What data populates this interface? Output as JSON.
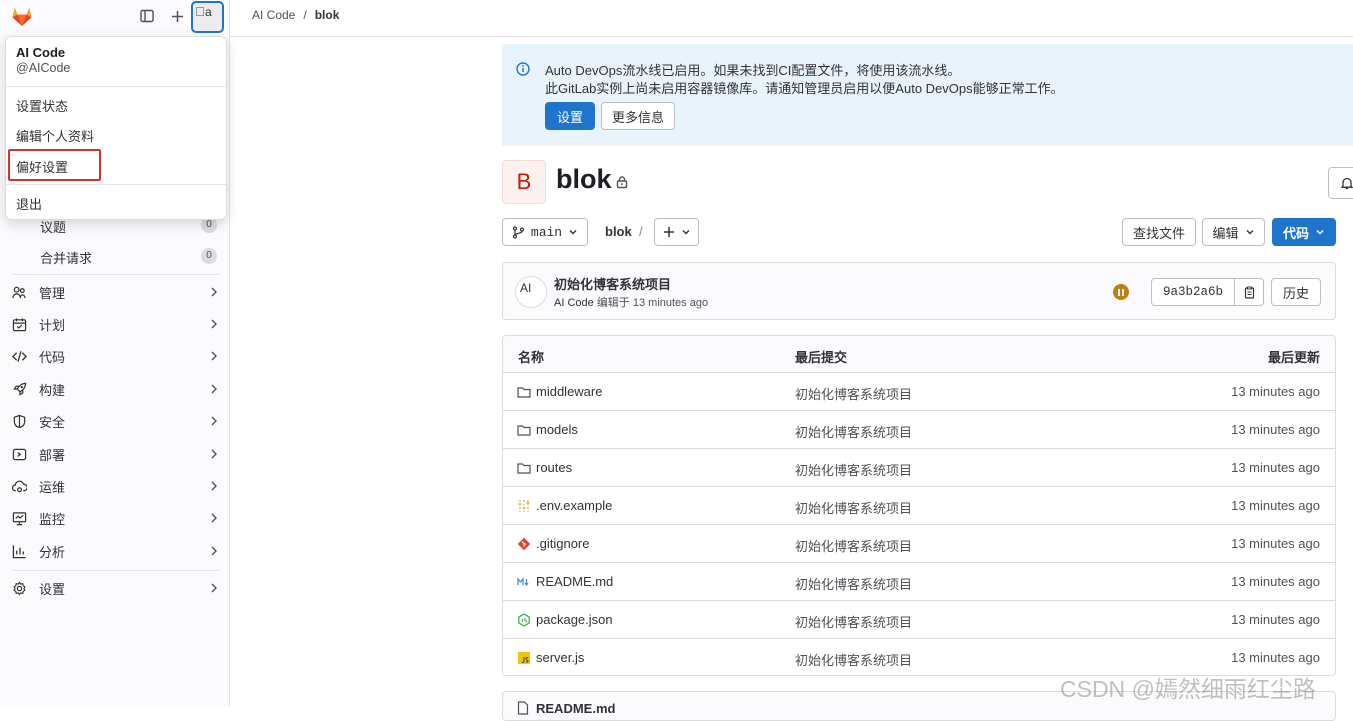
{
  "sidebar": {
    "avatar_alt": "a",
    "nav_sub": [
      {
        "label": "议题",
        "count": "0"
      },
      {
        "label": "合并请求",
        "count": "0"
      }
    ],
    "nav": [
      {
        "label": "管理",
        "icon": "users-icon"
      },
      {
        "label": "计划",
        "icon": "calendar-icon"
      },
      {
        "label": "代码",
        "icon": "code-icon"
      },
      {
        "label": "构建",
        "icon": "rocket-icon"
      },
      {
        "label": "安全",
        "icon": "shield-icon"
      },
      {
        "label": "部署",
        "icon": "deploy-icon"
      },
      {
        "label": "运维",
        "icon": "cloud-gear-icon"
      },
      {
        "label": "监控",
        "icon": "monitor-icon"
      },
      {
        "label": "分析",
        "icon": "chart-icon"
      }
    ],
    "settings_label": "设置"
  },
  "user_menu": {
    "name": "AI Code",
    "handle": "@AICode",
    "items": [
      "设置状态",
      "编辑个人资料",
      "偏好设置"
    ],
    "logout": "退出"
  },
  "breadcrumb": {
    "group": "AI Code",
    "sep": "/",
    "project": "blok"
  },
  "alert": {
    "line1": "Auto DevOps流水线已启用。如果未找到CI配置文件，将使用该流水线。",
    "line2": "此GitLab实例上尚未启用容器镜像库。请通知管理员启用以便Auto DevOps能够正常工作。",
    "settings_button": "设置",
    "more_info_button": "更多信息"
  },
  "project": {
    "avatar_letter": "B",
    "name": "blok"
  },
  "repo_bar": {
    "branch": "main",
    "path": "blok",
    "path_sep": "/",
    "find_file": "查找文件",
    "edit": "编辑",
    "code": "代码"
  },
  "commit": {
    "avatar_alt": "AI",
    "title": "初始化博客系统项目",
    "author": "AI Code",
    "meta": "编辑于 13 minutes ago",
    "sha": "9a3b2a6b",
    "history": "历史"
  },
  "files": {
    "headers": {
      "name": "名称",
      "last_commit": "最后提交",
      "last_update": "最后更新"
    },
    "rows": [
      {
        "name": "middleware",
        "type": "folder",
        "commit": "初始化博客系统项目",
        "time": "13 minutes ago"
      },
      {
        "name": "models",
        "type": "folder",
        "commit": "初始化博客系统项目",
        "time": "13 minutes ago"
      },
      {
        "name": "routes",
        "type": "folder",
        "commit": "初始化博客系统项目",
        "time": "13 minutes ago"
      },
      {
        "name": ".env.example",
        "type": "env",
        "commit": "初始化博客系统项目",
        "time": "13 minutes ago"
      },
      {
        "name": ".gitignore",
        "type": "git",
        "commit": "初始化博客系统项目",
        "time": "13 minutes ago"
      },
      {
        "name": "README.md",
        "type": "markdown",
        "commit": "初始化博客系统项目",
        "time": "13 minutes ago"
      },
      {
        "name": "package.json",
        "type": "node",
        "commit": "初始化博客系统项目",
        "time": "13 minutes ago"
      },
      {
        "name": "server.js",
        "type": "js",
        "commit": "初始化博客系统项目",
        "time": "13 minutes ago"
      }
    ]
  },
  "readme_header": "README.md",
  "watermark": "CSDN @嫣然细雨红尘路",
  "colors": {
    "primary": "#1f75cb",
    "alert_bg": "#e9f3fc",
    "highlight": "#d3302f",
    "pipeline": "#c17d10"
  }
}
